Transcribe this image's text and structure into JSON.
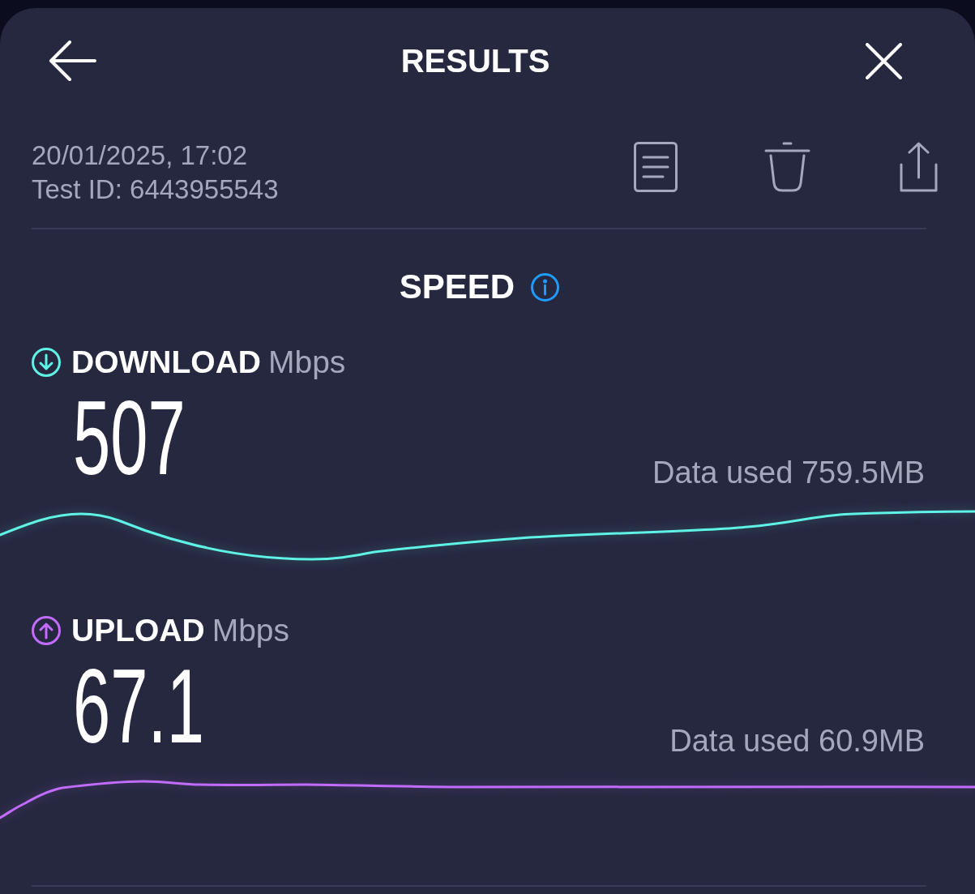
{
  "header": {
    "title": "RESULTS"
  },
  "test": {
    "date": "20/01/2025, 17:02",
    "test_id": "Test ID: 6443955543"
  },
  "speed": {
    "title": "SPEED"
  },
  "measurements": [
    {
      "kind": "download",
      "label": "DOWNLOAD",
      "unit": "Mbps",
      "value": "507",
      "data_used": "Data used 759.5MB",
      "color": "#5ff2e6"
    },
    {
      "kind": "upload",
      "label": "UPLOAD",
      "unit": "Mbps",
      "value": "67.1",
      "data_used": "Data used 60.9MB",
      "color": "#c26cff"
    }
  ]
}
